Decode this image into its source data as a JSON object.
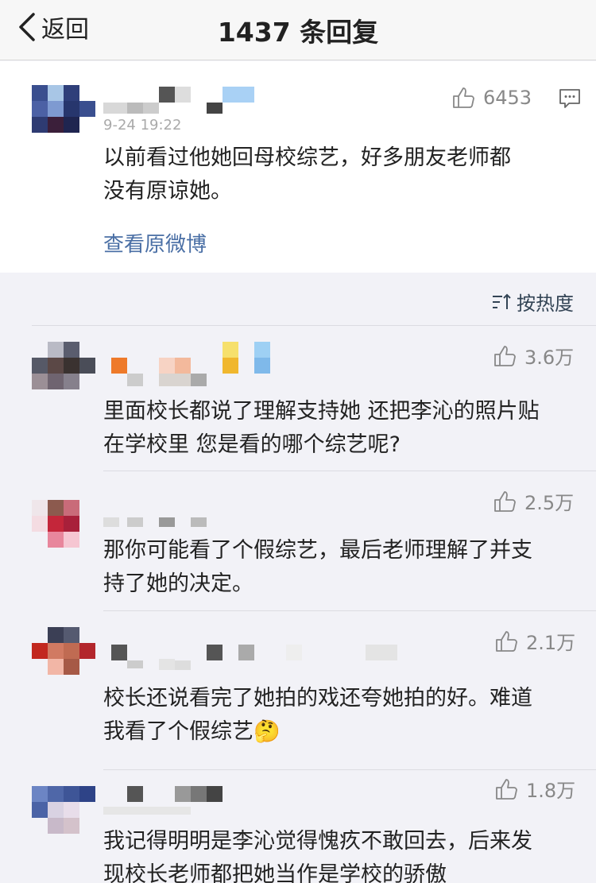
{
  "nav": {
    "back_label": "返回",
    "title": "1437 条回复"
  },
  "main_post": {
    "time": "9-24 19:22",
    "likes": "6453",
    "text_line1": "以前看过他她回母校综艺，好多朋友老师都",
    "text_line2": "没有原谅她。",
    "view_original": "查看原微博"
  },
  "sort": {
    "label": "按热度"
  },
  "replies": [
    {
      "likes": "3.6万",
      "line1": "里面校长都说了理解支持她 还把李沁的照片贴",
      "line2": "在学校里 您是看的哪个综艺呢?"
    },
    {
      "likes": "2.5万",
      "line1": "那你可能看了个假综艺，最后老师理解了并支",
      "line2": "持了她的决定。"
    },
    {
      "likes": "2.1万",
      "line1": "校长还说看完了她拍的戏还夸她拍的好。难道",
      "line2": "我看了个假综艺",
      "emoji": "🤔"
    },
    {
      "likes": "1.8万",
      "line1": "我记得明明是李沁觉得愧疚不敢回去，后来发",
      "line2": "现校长老师都把她当作是学校的骄傲"
    }
  ],
  "colors": {
    "link": "#4a6fa5",
    "background": "#f2f2f7",
    "card": "#ffffff"
  }
}
